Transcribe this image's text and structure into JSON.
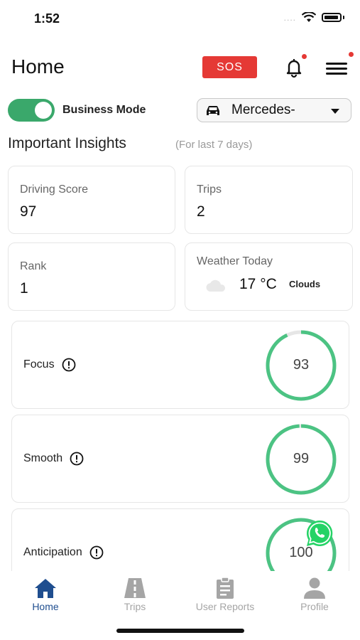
{
  "status_bar": {
    "time": "1:52",
    "signal_dots": "....",
    "wifi_icon": "wifi-icon",
    "battery_icon": "battery-icon"
  },
  "header": {
    "title": "Home",
    "sos_label": "SOS",
    "bell_icon": "bell-icon",
    "menu_icon": "hamburger-menu-icon"
  },
  "mode": {
    "label": "Business Mode",
    "enabled": true
  },
  "vehicle": {
    "selected": "Mercedes-"
  },
  "insights": {
    "title": "Important Insights",
    "subtitle": "(For last 7 days)",
    "cards": [
      {
        "label": "Driving Score",
        "value": "97"
      },
      {
        "label": "Trips",
        "value": "2"
      },
      {
        "label": "Rank",
        "value": "1"
      }
    ],
    "weather": {
      "label": "Weather Today",
      "temp": "17 °C",
      "condition": "Clouds",
      "icon": "cloud-icon"
    }
  },
  "scores": [
    {
      "label": "Focus",
      "value": "93",
      "fraction": 0.93
    },
    {
      "label": "Smooth",
      "value": "99",
      "fraction": 0.99
    },
    {
      "label": "Anticipation",
      "value": "100",
      "fraction": 1.0
    }
  ],
  "colors": {
    "accent_green": "#3aa86b",
    "ring_green": "#4cc383",
    "sos_red": "#e53935",
    "nav_active": "#1f4e8f",
    "whatsapp": "#25d366"
  },
  "nav": {
    "items": [
      {
        "label": "Home",
        "icon": "home-icon",
        "active": true
      },
      {
        "label": "Trips",
        "icon": "road-icon",
        "active": false
      },
      {
        "label": "User Reports",
        "icon": "clipboard-icon",
        "active": false
      },
      {
        "label": "Profile",
        "icon": "person-icon",
        "active": false
      }
    ]
  }
}
